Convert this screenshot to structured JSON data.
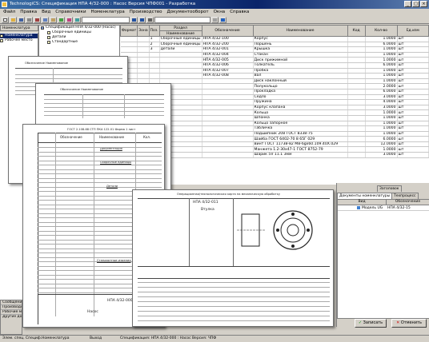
{
  "window": {
    "title": "TechnologiCS: Спецификация НПА 4/32-000 : Насос Версия ЧПФ001 - Разработка",
    "minimize_label": "_",
    "maximize_label": "□",
    "close_label": "×"
  },
  "menu": [
    "Файл",
    "Правка",
    "Вид",
    "Справочники",
    "Номенклатура",
    "Производство",
    "Документооборот",
    "Окна",
    "Справка"
  ],
  "left_tabs": {
    "tab_nomenclature": "Номенклатура",
    "items": [
      "Номенклатура",
      "Рабочее место"
    ]
  },
  "tree": {
    "root": "Спецификация НПА 4/32-000 (Насос)",
    "children": [
      "Сборочные единицы",
      "Детали",
      "Стандартные"
    ]
  },
  "main_table": {
    "headers": {
      "format": "Формат",
      "zone": "Зона",
      "pos": "Поз.",
      "section": "Раздел",
      "section_sub": "Наименование",
      "designation": "Обозначение",
      "name": "Наименование",
      "code": "Код",
      "qty": "Кол-во",
      "unit": "Ед.изм"
    },
    "rows": [
      {
        "pos": "1",
        "section": "Сборочные единицы",
        "designation": "НПА 4/32-100",
        "name": "Корпус",
        "qty": "1.0000",
        "unit": "шт"
      },
      {
        "pos": "2",
        "section": "Сборочные единицы",
        "designation": "НПА 4/32-200",
        "name": "Поршень",
        "qty": "6.0000",
        "unit": "шт"
      },
      {
        "pos": "3",
        "section": "Детали",
        "designation": "НПА 4/32-001",
        "name": "Крышка",
        "qty": "1.0000",
        "unit": "шт"
      },
      {
        "pos": "",
        "section": "",
        "designation": "НПА 4/32-004",
        "name": "Стакан",
        "qty": "1.0000",
        "unit": "шт"
      },
      {
        "pos": "",
        "section": "",
        "designation": "НПА 4/32-005",
        "name": "Диск прижимной",
        "qty": "1.0000",
        "unit": "шт"
      },
      {
        "pos": "",
        "section": "",
        "designation": "НПА 4/32-006",
        "name": "Толкатель",
        "qty": "6.0000",
        "unit": "шт"
      },
      {
        "pos": "",
        "section": "",
        "designation": "НПА 4/32-007",
        "name": "Пробка",
        "qty": "1.0000",
        "unit": "шт"
      },
      {
        "pos": "",
        "section": "",
        "designation": "НПА 4/32-008",
        "name": "Вал",
        "qty": "1.0000",
        "unit": "шт"
      },
      {
        "pos": "",
        "section": "",
        "designation": "",
        "name": "Диск наклонный",
        "qty": "1.0000",
        "unit": "шт"
      },
      {
        "pos": "",
        "section": "",
        "designation": "",
        "name": "Полукольцо",
        "qty": "2.0000",
        "unit": "шт"
      },
      {
        "pos": "",
        "section": "",
        "designation": "",
        "name": "Прокладка",
        "qty": "6.0000",
        "unit": "шт"
      },
      {
        "pos": "",
        "section": "",
        "designation": "",
        "name": "Седло",
        "qty": "3.0000",
        "unit": "шт"
      },
      {
        "pos": "",
        "section": "",
        "designation": "",
        "name": "Пружина",
        "qty": "4.0000",
        "unit": "шт"
      },
      {
        "pos": "",
        "section": "",
        "designation": "",
        "name": "Корпус клапана",
        "qty": "3.0000",
        "unit": "шт"
      },
      {
        "pos": "",
        "section": "",
        "designation": "",
        "name": "Кольцо",
        "qty": "1.0000",
        "unit": "шт"
      },
      {
        "pos": "",
        "section": "",
        "designation": "",
        "name": "Шпонка",
        "qty": "1.0000",
        "unit": "шт"
      },
      {
        "pos": "",
        "section": "",
        "designation": "",
        "name": "Кольцо запорное",
        "qty": "1.0000",
        "unit": "шт"
      },
      {
        "pos": "",
        "section": "",
        "designation": "",
        "name": "Табличка",
        "qty": "1.0000",
        "unit": "шт"
      },
      {
        "pos": "",
        "section": "",
        "designation": "",
        "name": "Подшипник 208 ГОСТ 8338-75",
        "qty": "1.0000",
        "unit": "шт"
      },
      {
        "pos": "",
        "section": "",
        "designation": "",
        "name": "Шайба ГОСТ 6402-70 8 65Г 029",
        "qty": "6.0000",
        "unit": "шт"
      },
      {
        "pos": "",
        "section": "",
        "designation": "",
        "name": "Винт ГОСТ 11738-82 М8-6gx60.109.40Х.029",
        "qty": "12.0000",
        "unit": "шт"
      },
      {
        "pos": "",
        "section": "",
        "designation": "",
        "name": "Манжета 1.2-30х47-1 ГОСТ 8752-79",
        "qty": "1.0000",
        "unit": "шт"
      },
      {
        "pos": "",
        "section": "",
        "designation": "",
        "name": "Шарик 5V 11.1 3мм",
        "qty": "3.0000",
        "unit": "шт"
      }
    ]
  },
  "papers": {
    "p1_title": "Обозначение   Наименование",
    "p2_title": "Обозначение   Наименование",
    "p3_header": "ГОСТ 2.108-68  СТП ПКА 122-01  Форма 1 лист",
    "p3_cols": [
      "Обозначение",
      "Наименование",
      "Кол."
    ],
    "p3_sections": [
      "Документация",
      "Сборочные единицы",
      "Детали",
      "Стандартные изделия"
    ],
    "p3_code": "НПА 4/32-000",
    "p3_title": "Насос",
    "p4_title": "Операционная/технологическая карта на механическую обработку",
    "p4_code": "НПА 4/32-011",
    "p4_part": "Втулка"
  },
  "bottom_right": {
    "tabs": [
      "Заголовок",
      "Документы номенклатуры",
      "Техпроцесс"
    ],
    "headers": [
      "Вид",
      "Обозначение"
    ],
    "row_kind": "Модель UG",
    "row_designation": "НПА 4/32-15",
    "save_label": "Записать",
    "cancel_label": "Отменить"
  },
  "left_bottom": {
    "items": [
      "Сообщения",
      "Производство",
      "Рабочие места",
      "Другие документы"
    ]
  },
  "status": {
    "tabs": [
      "Элем. спец.",
      "Специф.",
      "Номенклатура",
      "Выход"
    ],
    "text": "Спецификация: НПА 4/32-000 : Насос Версия: ЧПФ"
  }
}
